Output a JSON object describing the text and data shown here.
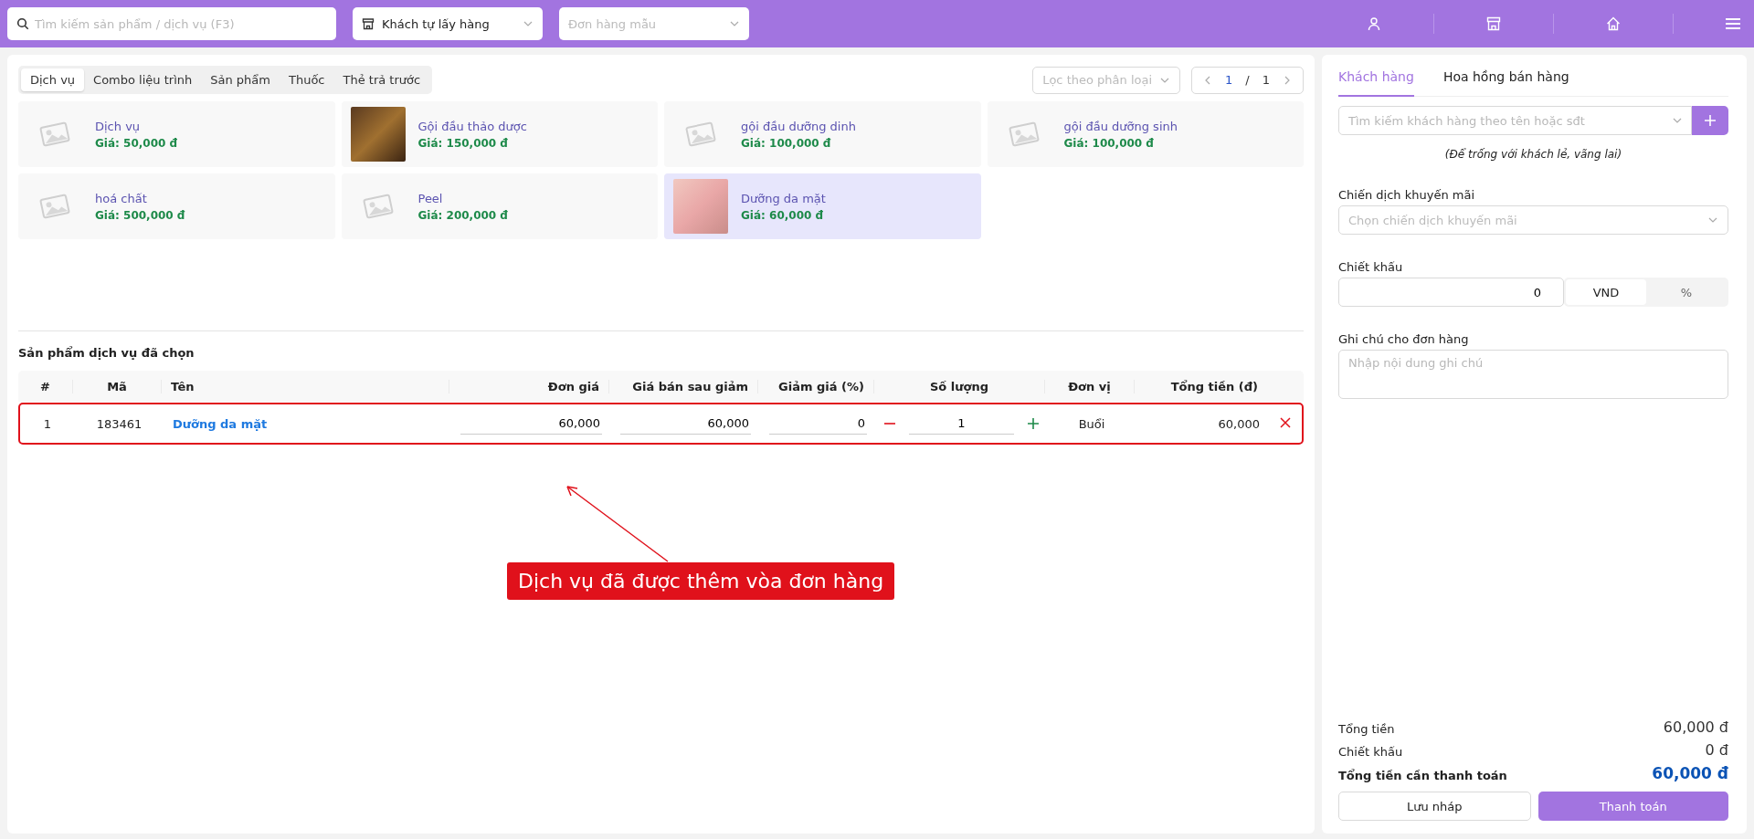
{
  "topbar": {
    "search": {
      "placeholder": "Tìm kiếm sản phẩm / dịch vụ (F3)"
    },
    "delivery": {
      "value": "Khách tự lấy hàng"
    },
    "template": {
      "placeholder": "Đơn hàng mẫu"
    }
  },
  "category_tabs": [
    {
      "label": "Dịch vụ",
      "selected": true
    },
    {
      "label": "Combo liệu trình",
      "selected": false
    },
    {
      "label": "Sản phẩm",
      "selected": false
    },
    {
      "label": "Thuốc",
      "selected": false
    },
    {
      "label": "Thẻ trả trước",
      "selected": false
    }
  ],
  "filter": {
    "placeholder": "Lọc theo phân loại"
  },
  "pager": {
    "current": "1",
    "separator": "/",
    "total": "1"
  },
  "products": [
    {
      "name": "Dịch vụ",
      "price": "Giá: 50,000 đ",
      "kind": "placeholder",
      "selected": false
    },
    {
      "name": "Gội đầu thảo dược",
      "price": "Giá: 150,000 đ",
      "kind": "photo",
      "selected": false
    },
    {
      "name": "gội đầu dưỡng dinh",
      "price": "Giá: 100,000 đ",
      "kind": "placeholder",
      "selected": false
    },
    {
      "name": "gội đầu dưỡng sinh",
      "price": "Giá: 100,000 đ",
      "kind": "placeholder",
      "selected": false
    },
    {
      "name": "hoá chất",
      "price": "Giá: 500,000 đ",
      "kind": "placeholder",
      "selected": false
    },
    {
      "name": "Peel",
      "price": "Giá: 200,000 đ",
      "kind": "placeholder",
      "selected": false
    },
    {
      "name": "Dưỡng da mặt",
      "price": "Giá: 60,000 đ",
      "kind": "photo",
      "selected": true
    }
  ],
  "selected_section": {
    "title": "Sản phẩm dịch vụ đã chọn",
    "columns": [
      "#",
      "Mã",
      "Tên",
      "Đơn giá",
      "Giá bán sau giảm",
      "Giảm giá (%)",
      "Số lượng",
      "Đơn vị",
      "Tổng tiền (đ)"
    ],
    "rows": [
      {
        "index": "1",
        "code": "183461",
        "name": "Dưỡng da mặt",
        "unit_price": "60,000",
        "sale_price": "60,000",
        "discount": "0",
        "quantity": "1",
        "unit": "Buổi",
        "total": "60,000",
        "highlighted": true
      }
    ]
  },
  "annotation": {
    "text": "Dịch vụ đã được thêm vòa đơn hàng"
  },
  "right_tabs": [
    {
      "label": "Khách hàng",
      "selected": true
    },
    {
      "label": "Hoa hồng bán hàng",
      "selected": false
    }
  ],
  "customer": {
    "placeholder": "Tìm kiếm khách hàng theo tên hoặc sđt",
    "hint": "(Để trống với khách lẻ, vãng lai)"
  },
  "promotion": {
    "label": "Chiến dịch khuyến mãi",
    "placeholder": "Chọn chiến dịch khuyến mãi"
  },
  "discount": {
    "label": "Chiết khấu",
    "value": "0",
    "units": [
      {
        "label": "VND",
        "selected": true
      },
      {
        "label": "%",
        "selected": false
      }
    ]
  },
  "note": {
    "label": "Ghi chú cho đơn hàng",
    "placeholder": "Nhập nội dung ghi chú"
  },
  "summary": [
    {
      "label": "Tổng tiền",
      "value": "60,000 đ",
      "kind": "normal"
    },
    {
      "label": "Chiết khấu",
      "value": "0 đ",
      "kind": "normal"
    },
    {
      "label": "Tổng tiền cần thanh toán",
      "value": "60,000 đ",
      "kind": "total"
    }
  ],
  "actions": [
    {
      "label": "Lưu nháp",
      "kind": "secondary"
    },
    {
      "label": "Thanh toán",
      "kind": "primary"
    }
  ]
}
